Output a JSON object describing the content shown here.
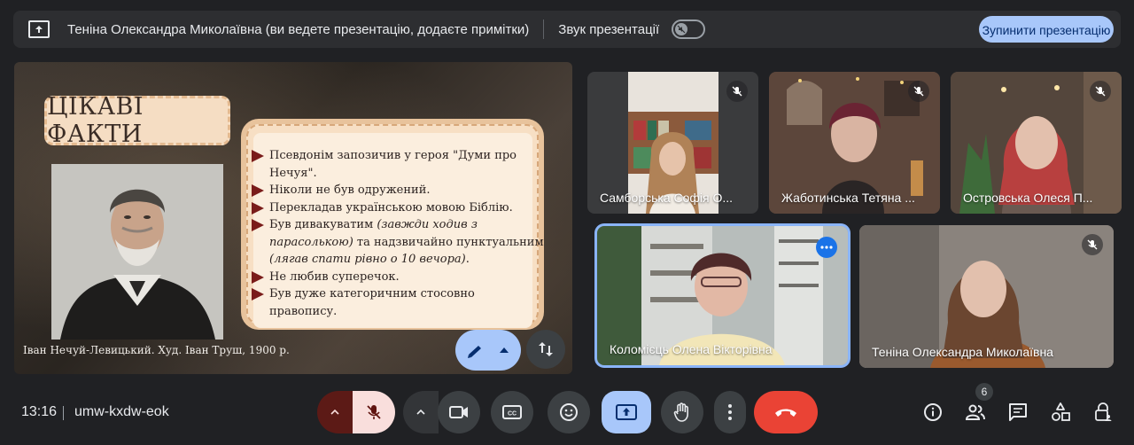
{
  "topbar": {
    "presenter_text": "Теніна Олександра Миколаївна (ви ведете презентацію, додаєте примітки)",
    "sound_label": "Звук презентації",
    "stop_button": "Зупинити презентацію"
  },
  "slide": {
    "title": "ЦІКАВІ ФАКТИ",
    "caption": "Іван Нечуй-Левицький. Худ. Іван Труш, 1900 р.",
    "facts": [
      {
        "text": "Псевдонім запозичив у героя  \"Думи про Нечуя\".",
        "italic": ""
      },
      {
        "text": "Ніколи не був одружений.",
        "italic": ""
      },
      {
        "text": "Перекладав українською мовою Біблію.",
        "italic": ""
      },
      {
        "text": "Був дивакуватим ",
        "italic": "(завжди ходив з парасолькою)",
        "tail": " та надзвичайно пунктуальним ",
        "italic2": "(лягав спати рівно о 10 вечора)",
        "tail2": "."
      },
      {
        "text": "Не любив суперечок.",
        "italic": ""
      },
      {
        "text": "Був дуже категоричним стосовно правопису.",
        "italic": ""
      }
    ]
  },
  "participants": [
    {
      "name": "Самборська Софія О...",
      "muted": true
    },
    {
      "name": "Жаботинська Тетяна ...",
      "muted": true
    },
    {
      "name": "Островська Олеся П...",
      "muted": true
    },
    {
      "name": "Коломієць Олена Вікторівна",
      "muted": false
    },
    {
      "name": "Теніна Олександра Миколаївна",
      "muted": true
    }
  ],
  "bottombar": {
    "time": "13:16",
    "meeting_code": "umw-kxdw-eok",
    "people_count": "6"
  },
  "colors": {
    "accent": "#a8c7fa",
    "end_call": "#ea4335",
    "mic_off_bg": "#f9dedc",
    "speaking_border": "#8ab4f8"
  }
}
